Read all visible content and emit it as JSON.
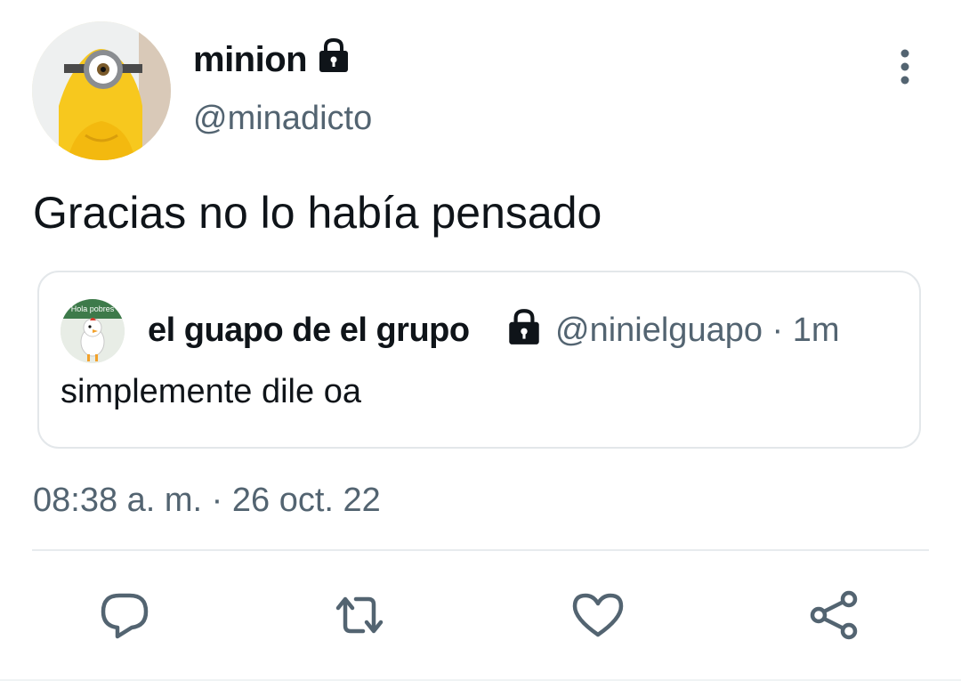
{
  "tweet": {
    "author": {
      "display_name": "minion",
      "handle": "@minadicto",
      "protected": true,
      "avatar": "minion-avatar"
    },
    "text": "Gracias no lo había pensado",
    "quoted": {
      "display_name": "el guapo de el grupo",
      "handle_time": "@ninielguapo · 1m",
      "protected": true,
      "avatar_caption": "Hola pobres",
      "text": "simplemente dile oa"
    },
    "timestamp": "08:38 a. m. · 26 oct. 22"
  },
  "actions": [
    {
      "name": "reply",
      "icon": "comment-icon"
    },
    {
      "name": "retweet",
      "icon": "retweet-icon"
    },
    {
      "name": "like",
      "icon": "heart-icon"
    },
    {
      "name": "share",
      "icon": "share-icon"
    }
  ],
  "colors": {
    "text_primary": "#0f1419",
    "text_secondary": "#536471",
    "border": "#e3e7ea",
    "icon": "#536471"
  }
}
